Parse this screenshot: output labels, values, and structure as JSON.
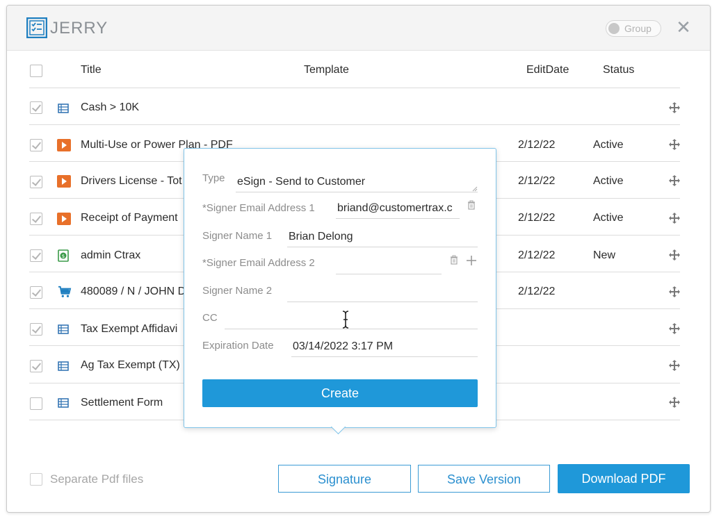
{
  "app": {
    "brand": "JERRY",
    "group_toggle_label": "Group"
  },
  "table": {
    "columns": {
      "title": "Title",
      "template": "Template",
      "edit_date": "EditDate",
      "status": "Status"
    },
    "rows": [
      {
        "title": "Cash > 10K",
        "icon": "table-icon",
        "date": "",
        "status": ""
      },
      {
        "title": "Multi-Use or Power Plan - PDF",
        "icon": "pdf-play-icon",
        "date": "2/12/22",
        "status": "Active"
      },
      {
        "title": "Drivers License - Tot",
        "icon": "pdf-play-icon",
        "date": "2/12/22",
        "status": "Active"
      },
      {
        "title": "Receipt of Payment",
        "icon": "pdf-play-icon",
        "date": "2/12/22",
        "status": "Active"
      },
      {
        "title": "admin Ctrax",
        "icon": "money-doc-icon",
        "date": "2/12/22",
        "status": "New"
      },
      {
        "title": "480089 / N / JOHN D",
        "icon": "cart-icon",
        "date": "2/12/22",
        "status": ""
      },
      {
        "title": "Tax Exempt Affidavi",
        "icon": "table-icon",
        "date": "",
        "status": ""
      },
      {
        "title": "Ag Tax Exempt (TX)",
        "icon": "table-icon",
        "date": "",
        "status": ""
      },
      {
        "title": "Settlement Form",
        "icon": "table-icon",
        "date": "",
        "status": ""
      }
    ]
  },
  "footer": {
    "separate_pdf_label": "Separate Pdf files",
    "signature_label": "Signature",
    "save_version_label": "Save Version",
    "download_pdf_label": "Download PDF"
  },
  "esign_form": {
    "type_label": "Type",
    "type_value": "eSign - Send to Customer",
    "signer_email_1_label": "*Signer Email Address 1",
    "signer_email_1_value": "briand@customertrax.c",
    "signer_name_1_label": "Signer Name 1",
    "signer_name_1_value": "Brian Delong",
    "signer_email_2_label": "*Signer Email Address 2",
    "signer_email_2_value": "",
    "signer_name_2_label": "Signer Name 2",
    "signer_name_2_value": "",
    "cc_label": "CC",
    "cc_value": "",
    "expiration_label": "Expiration Date",
    "expiration_value": "03/14/2022 3:17 PM",
    "create_label": "Create"
  },
  "colors": {
    "accent": "#1f98d9",
    "pdf_orange": "#e8702a",
    "money_green": "#3a9a48",
    "table_blue": "#2a6fb0"
  }
}
